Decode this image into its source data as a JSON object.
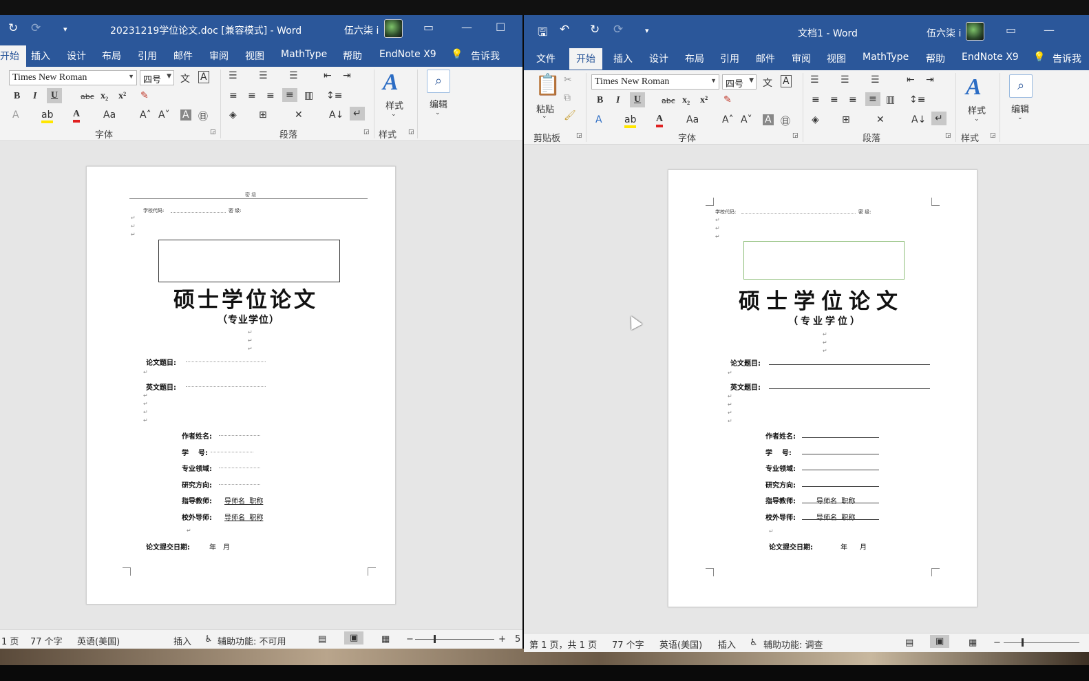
{
  "left_window": {
    "title": "20231219学位论文.doc [兼容模式] - Word",
    "user": "伍六柒 i",
    "tabs": [
      "开始",
      "插入",
      "设计",
      "布局",
      "引用",
      "邮件",
      "审阅",
      "视图",
      "MathType",
      "帮助",
      "EndNote X9"
    ],
    "tell_me": "告诉我",
    "font_name": "Times New Roman",
    "font_size": "四号",
    "groups": {
      "font": "字体",
      "paragraph": "段落",
      "styles": "样式"
    },
    "styles_label": "样式",
    "edit_label": "编辑",
    "status": {
      "page": "1 页",
      "words": "77 个字",
      "lang": "英语(美国)",
      "mode": "插入",
      "access": "辅助功能: 不可用",
      "zoom": "5"
    }
  },
  "right_window": {
    "title": "文档1 - Word",
    "user": "伍六柒 i",
    "tabs": [
      "文件",
      "开始",
      "插入",
      "设计",
      "布局",
      "引用",
      "邮件",
      "审阅",
      "视图",
      "MathType",
      "帮助",
      "EndNote X9"
    ],
    "tell_me": "告诉我",
    "font_name": "Times New Roman",
    "font_size": "四号",
    "paste_label": "粘贴",
    "groups": {
      "clipboard": "剪贴板",
      "font": "字体",
      "paragraph": "段落",
      "styles": "样式"
    },
    "styles_label": "样式",
    "edit_label": "编辑",
    "status": {
      "page": "第 1 页，共 1 页",
      "words": "77 个字",
      "lang": "英语(美国)",
      "mode": "插入",
      "access": "辅助功能: 调查"
    }
  },
  "document": {
    "header_text": "密 级",
    "school_code": "学校代码:",
    "secrecy": "密 级:",
    "title": "硕士学位论文",
    "subtitle": "（专业学位）",
    "cn_title_label": "论文题目:",
    "en_title_label": "英文题目:",
    "author_label": "作者姓名:",
    "student_id_label": "学    号:",
    "field_label": "专业领域:",
    "direction_label": "研究方向:",
    "advisor_label": "指导教师:",
    "advisor_value": "导师名  职称",
    "external_label": "校外导师:",
    "external_value": "导师名  职称",
    "date_label": "论文提交日期:",
    "year": "年",
    "month": "月"
  }
}
